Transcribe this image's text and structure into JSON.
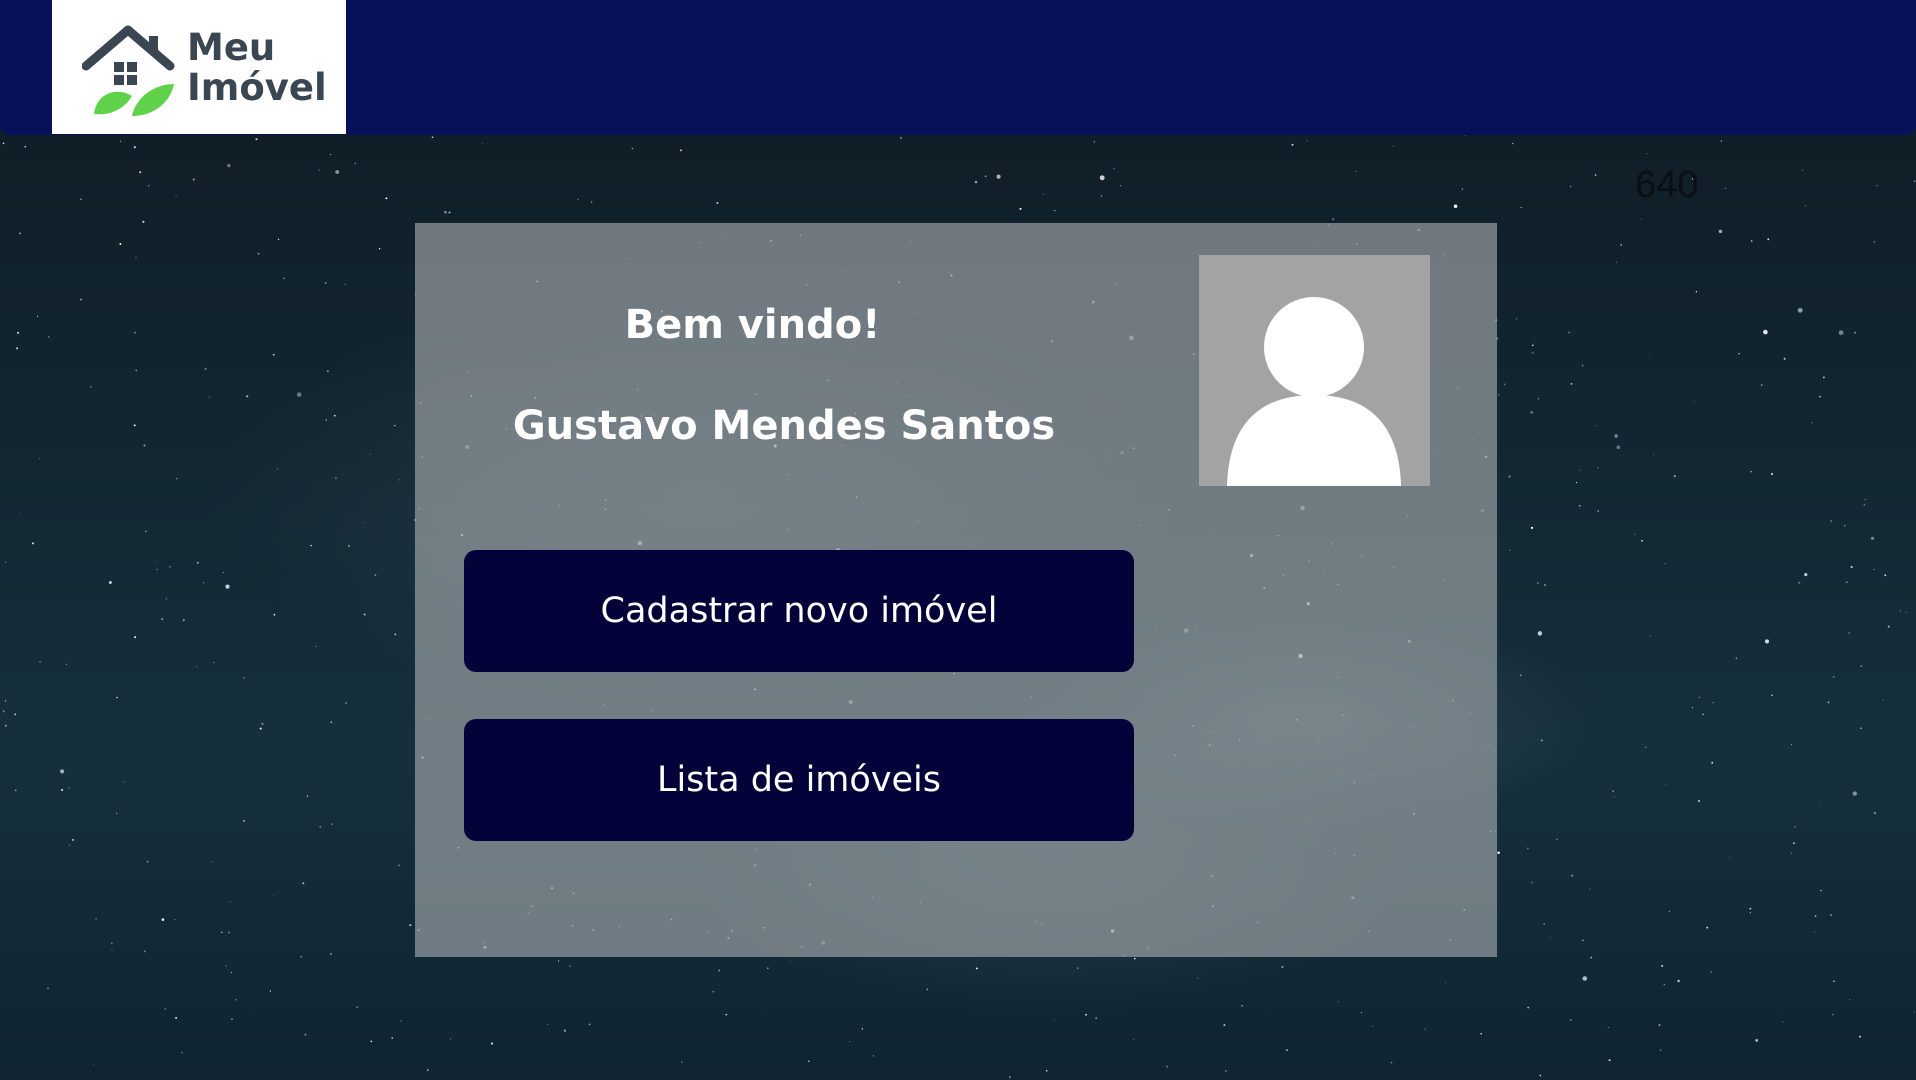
{
  "header": {
    "logo": {
      "line1": "Meu",
      "line2": "Imóvel",
      "icon": "house-leaf-icon",
      "colors": {
        "roof": "#3a4652",
        "leaf": "#5fd14b",
        "text": "#3a4652"
      }
    },
    "background_color": "#06115a"
  },
  "counter": "640",
  "card": {
    "welcome": "Bem vindo!",
    "user_name": "Gustavo Mendes Santos",
    "avatar_icon": "user-placeholder-icon",
    "buttons": {
      "register": "Cadastrar novo imóvel",
      "list": "Lista de imóveis"
    },
    "button_color": "#03033a"
  }
}
